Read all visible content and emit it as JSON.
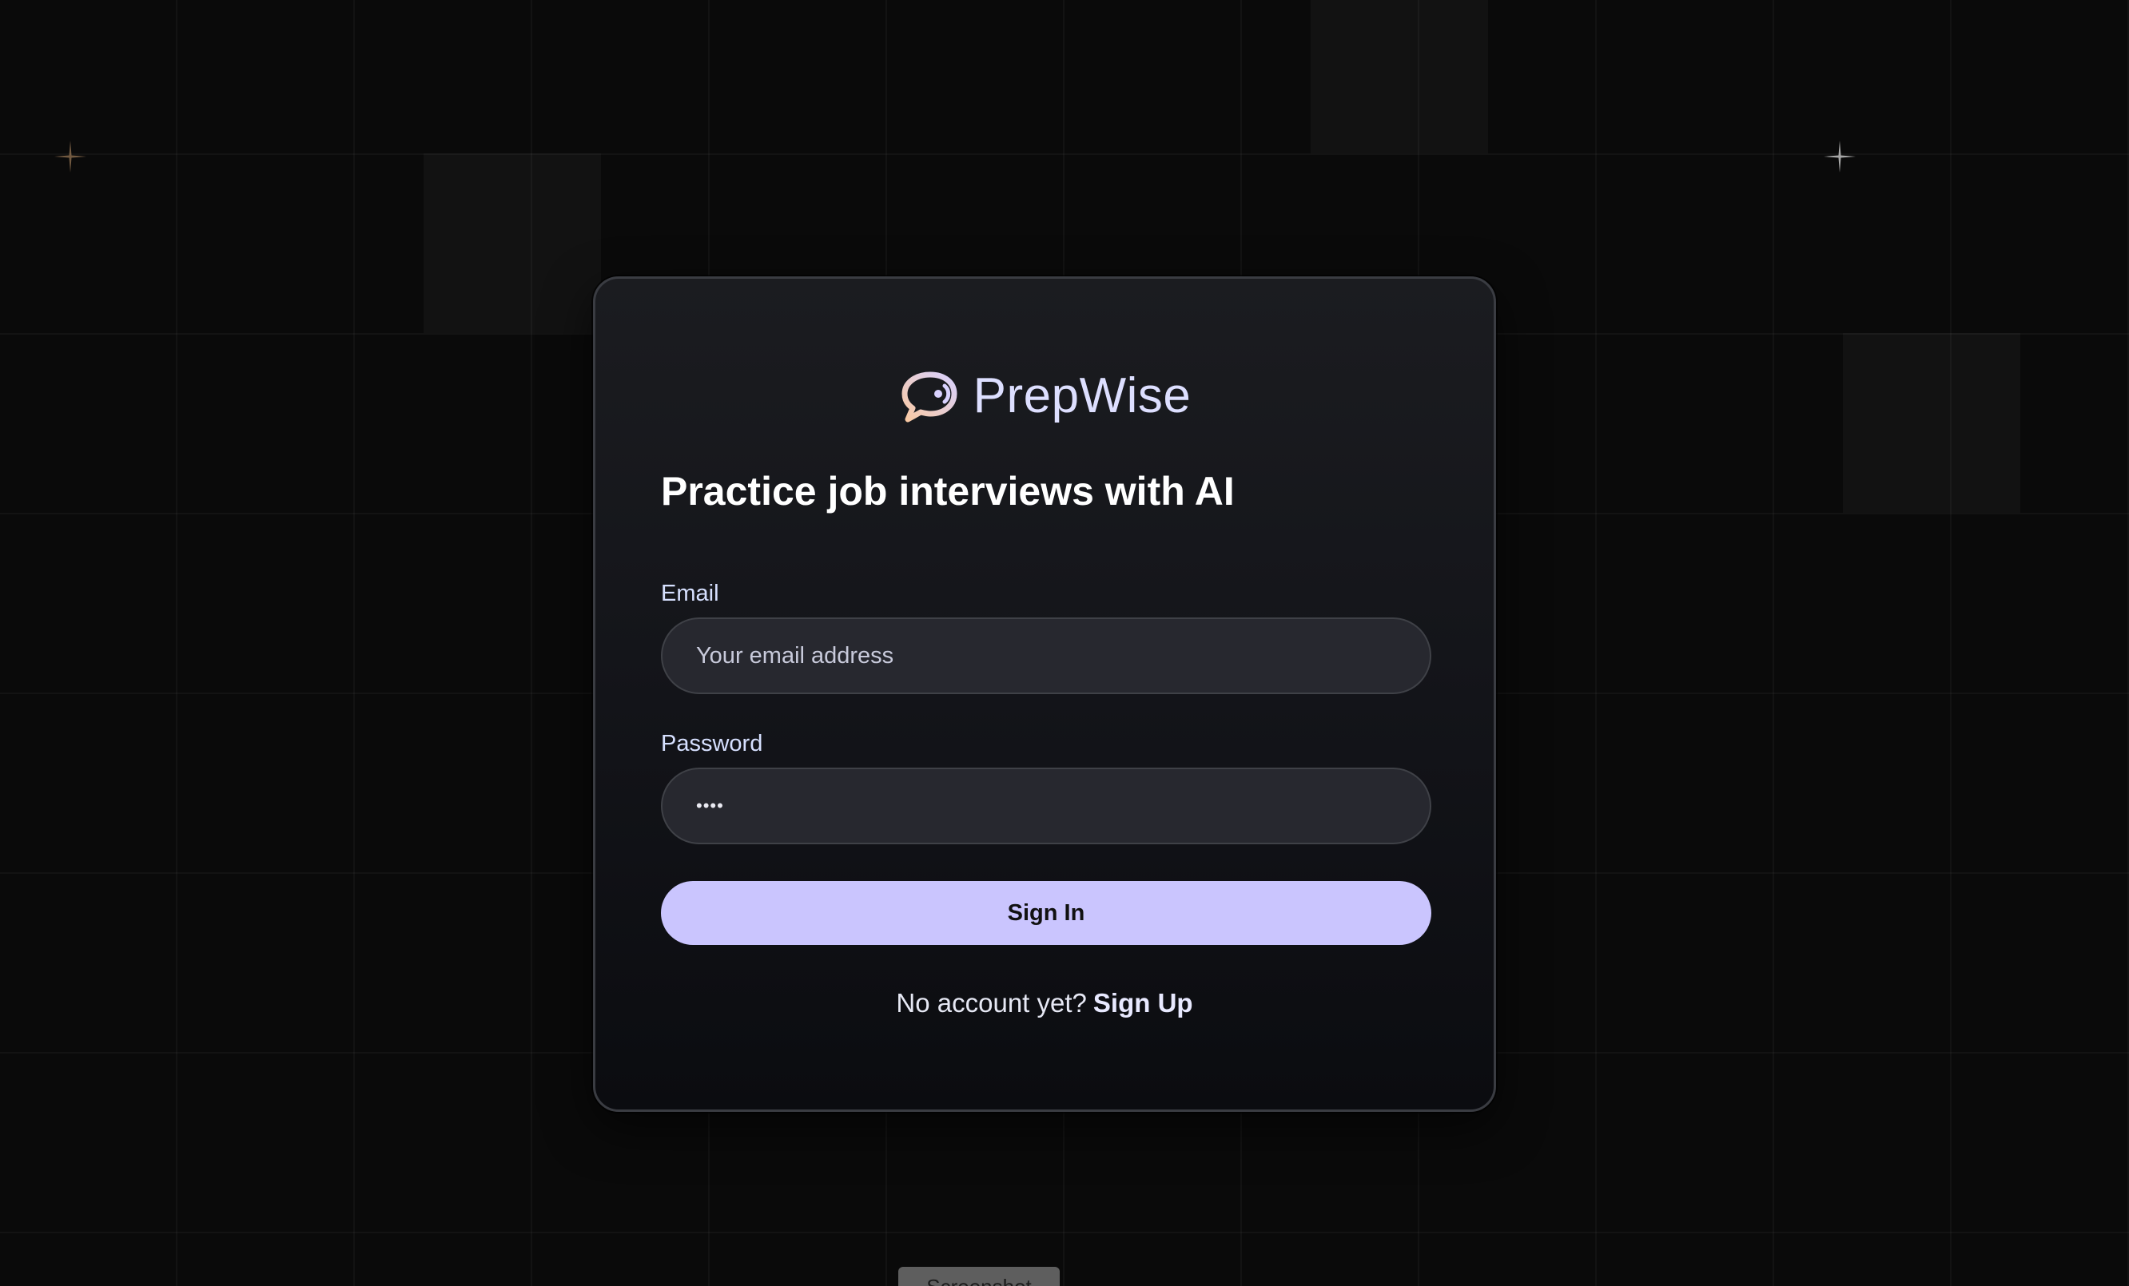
{
  "brand": {
    "name": "PrepWise",
    "logo_icon": "chat-bubble-icon",
    "logo_colors": [
      "#f9c9a3",
      "#d9d2ff"
    ]
  },
  "heading": "Practice job interviews with AI",
  "form": {
    "email": {
      "label": "Email",
      "placeholder": "Your email address",
      "value": ""
    },
    "password": {
      "label": "Password",
      "value": "••••"
    },
    "submit_label": "Sign In"
  },
  "footer": {
    "prompt": "No account yet?",
    "link_label": "Sign Up"
  },
  "overlay": {
    "label": "Screenshot"
  },
  "colors": {
    "accent": "#cac5fe",
    "background": "#0a0a0a",
    "card_border": "#3a3c42",
    "input_background": "#27282f",
    "brand_text": "#dddfff"
  }
}
